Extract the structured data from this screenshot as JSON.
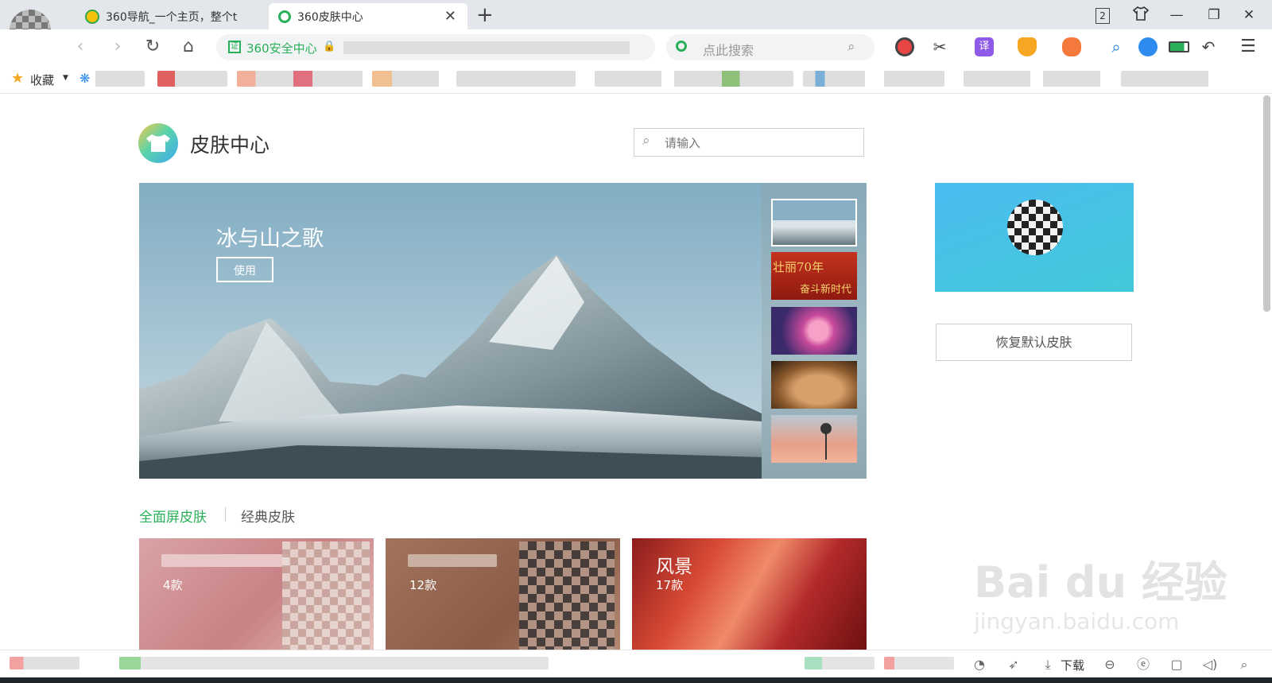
{
  "browser": {
    "tabs": [
      {
        "label": "360导航_一个主页，整个t",
        "active": false
      },
      {
        "label": "360皮肤中心",
        "active": true
      }
    ],
    "tab_count": "2",
    "url_badge": "360安全中心",
    "search_placeholder": "点此搜索",
    "bookmarks_label": "收藏",
    "status_download": "下载"
  },
  "page": {
    "title": "皮肤中心",
    "search_placeholder": "请输入",
    "featured": {
      "name": "冰与山之歌",
      "use_label": "使用"
    },
    "thumb_text": {
      "line1": "壮丽70年",
      "line2": "奋斗新时代"
    },
    "restore_label": "恢复默认皮肤",
    "category_tabs": [
      "全面屏皮肤",
      "经典皮肤"
    ],
    "cards": [
      {
        "name": "",
        "count": "4款"
      },
      {
        "name": "",
        "count": "12款"
      },
      {
        "name": "风景",
        "count": "17款"
      }
    ]
  },
  "watermark": {
    "brand": "Bai du 经验",
    "url": "jingyan.baidu.com"
  },
  "colors": {
    "accent_green": "#2bb05a",
    "tab_bar": "#e3e6ea",
    "banner_sky": "#8fb5c9"
  },
  "icons": [
    "avatar",
    "back-icon",
    "forward-icon",
    "refresh-icon",
    "home-icon",
    "shield-icon",
    "lock-icon",
    "search-icon",
    "tshirt-icon",
    "close-icon",
    "plus-icon",
    "star-icon",
    "paw-icon",
    "scissors-icon",
    "translate-icon",
    "game-icon",
    "undo-icon",
    "menu-icon"
  ]
}
